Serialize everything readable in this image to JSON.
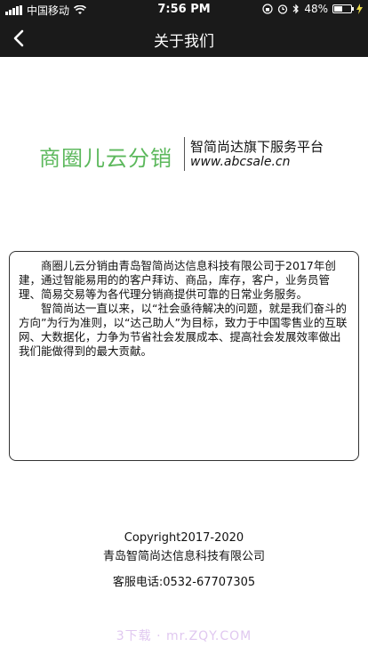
{
  "status_bar": {
    "carrier": "中国移动",
    "time": "7:56 PM",
    "battery_percent": "48%",
    "battery_level": 0.48,
    "icons": [
      "signal-icon",
      "wifi-icon",
      "orientation-lock-icon",
      "alarm-icon",
      "bluetooth-icon",
      "battery-icon",
      "charging-icon"
    ]
  },
  "navbar": {
    "title": "关于我们",
    "back_icon": "chevron-left-icon"
  },
  "brand": {
    "name": "商圈儿云分销",
    "slogan": "智简尚达旗下服务平台",
    "url": "www.abcsale.cn",
    "color": "#5cb85c"
  },
  "description": {
    "paragraph1": "商圈儿云分销由青岛智简尚达信息科技有限公司于2017年创建，通过智能易用的的客户拜访、商品，库存，客户，业务员管理、简易交易等为各代理分销商提供可靠的日常业务服务。",
    "paragraph2": "智简尚达一直以来，以“社会亟待解决的问题，就是我们奋斗的方向”为行为准则，以“达己助人”为目标，致力于中国零售业的互联网、大数据化，力争为节省社会发展成本、提高社会发展效率做出我们能做得到的最大贡献。"
  },
  "footer": {
    "copyright": "Copyright2017-2020",
    "company": "青岛智简尚达信息科技有限公司",
    "phone": "客服电话:0532-67707305"
  },
  "watermark": {
    "text": "3下载 · mr.ZQY.COM"
  }
}
